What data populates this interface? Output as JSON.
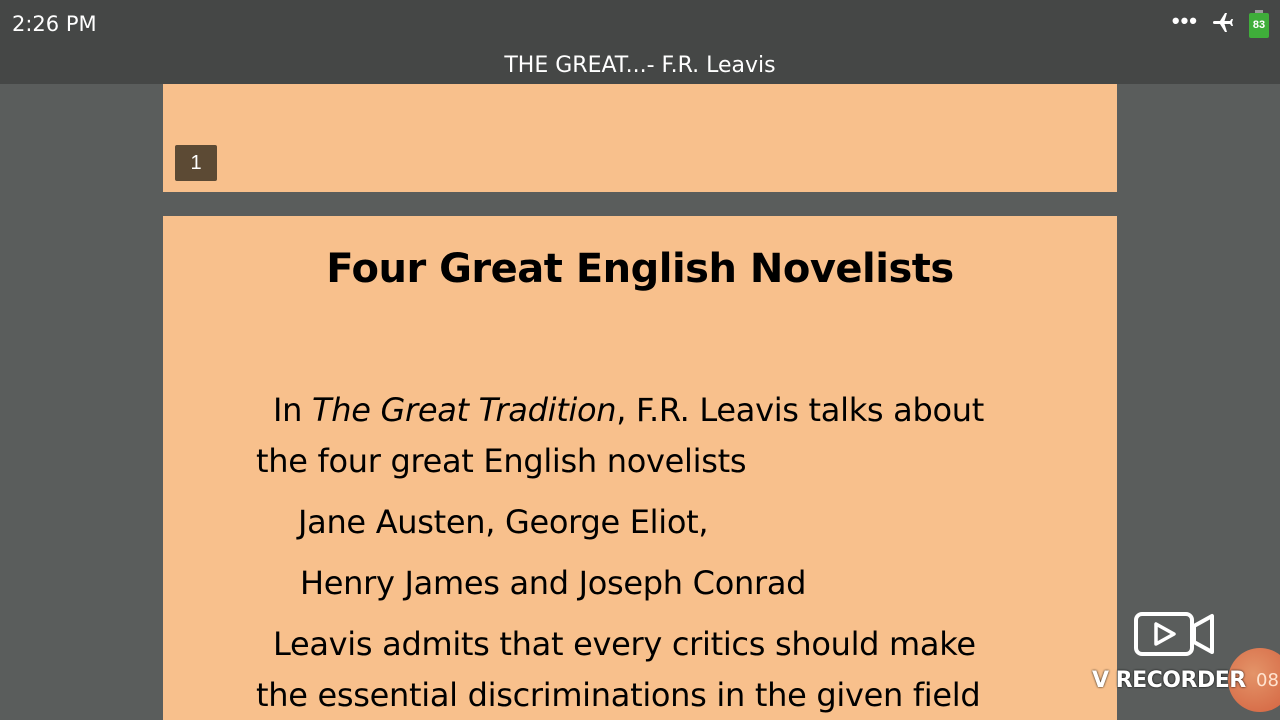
{
  "status_bar": {
    "time": "2:26 PM",
    "more_icon": "ellipsis-icon",
    "airplane_icon": "airplane-mode-icon",
    "battery_level": "83",
    "battery_color": "#3fae3a"
  },
  "title_bar": {
    "title": "THE GREAT...- F.R. Leavis"
  },
  "slides": [
    {
      "page_number": "1"
    },
    {
      "title": "Four Great English Novelists",
      "line1_prefix": "In ",
      "line1_italic": "The Great Tradition",
      "line1_suffix": ", F.R. Leavis talks about",
      "line2": "the four great English novelists",
      "line3": "Jane Austen, George Eliot,",
      "line4": "Henry James and Joseph Conrad",
      "line5": "Leavis admits that every critics should make",
      "line6": "the essential discriminations in the given field"
    }
  ],
  "recorder_overlay": {
    "label": "V RECORDER",
    "timer": "08",
    "icon": "video-camera-icon"
  },
  "colors": {
    "slide_background": "#f8c08c",
    "viewer_background": "#5a5d5c",
    "bar_background": "#454746",
    "page_badge": "#5c4a34"
  }
}
